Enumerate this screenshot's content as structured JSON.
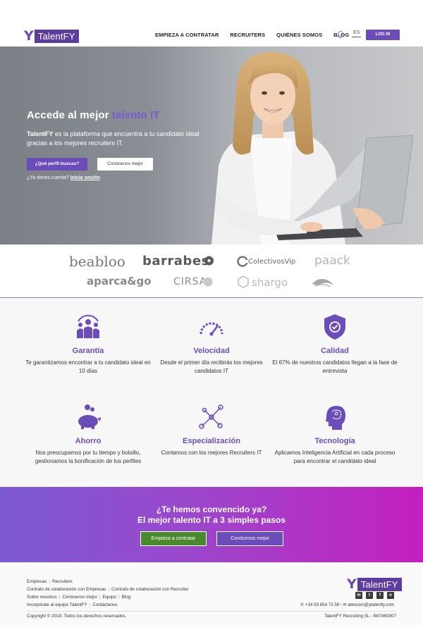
{
  "header": {
    "logo_text": "TalentFY",
    "nav": [
      "EMPIEZA A CONTRATAR",
      "RECRUITERS",
      "QUIÉNES SOMOS",
      "BLOG"
    ],
    "lang": "ES",
    "login": "LOG IN"
  },
  "hero": {
    "title_start": "Accede al mejor ",
    "title_accent": "talento IT",
    "desc_brand": "TalentFY",
    "desc_rest": " es la plataforma que encuentra a tu candidato ideal gracias a los mejores recruiters IT.",
    "btn_primary": "¿Qué perfil buscas?",
    "btn_secondary": "Conócenos mejor",
    "account_q": "¿Ya tienes cuenta? ",
    "account_link": "Inicia sesión"
  },
  "clients": [
    "beabloo",
    "barrabes",
    "ColectivosVip",
    "paack",
    "aparca&go",
    "CIRSA",
    "shargo"
  ],
  "features": [
    {
      "icon": "team-icon",
      "title": "Garantía",
      "text": "Te garantizamos encontrar a tu candidato ideal en 10 días"
    },
    {
      "icon": "speedometer-icon",
      "title": "Velocidad",
      "text": "Desde el primer día recibirás los mejores candidatos IT"
    },
    {
      "icon": "shield-check-icon",
      "title": "Calidad",
      "text": "El 67% de nuestros candidatos llegan a la fase de entrevista"
    },
    {
      "icon": "piggy-bank-icon",
      "title": "Ahorro",
      "text": "Nos preocupamos por tu tiempo y bolsillo, gestionamos la bonificación de tus perfiles"
    },
    {
      "icon": "network-icon",
      "title": "Especialización",
      "text": "Contamos con los mejores Recruiters IT"
    },
    {
      "icon": "ai-head-icon",
      "title": "Tecnología",
      "text": "Aplicamos Inteligencia Artificial en cada proceso para encontrar el candidato ideal"
    }
  ],
  "cta": {
    "line1": "¿Te hemos convencido ya?",
    "line2": "El mejor talento IT a 3 simples pasos",
    "btn1": "Empieza a contratar",
    "btn2": "Conócenos mejor"
  },
  "footer": {
    "row1": [
      "Empresas",
      "Recruiters"
    ],
    "row2": [
      "Contrato de colaboración con Empresas",
      "Contrato de colaboración con Recruiter"
    ],
    "row3": [
      "Sobre nosotros",
      "Conócenos mejor",
      "Equipo",
      "Blog"
    ],
    "row4": [
      "Incorpórate al equipo TalentFY",
      "Contáctanos"
    ],
    "logo_text": "TalentFY",
    "phone": "+34 93 854 73 58",
    "email": "atencion@ytalentfy.com",
    "copyright": "Copyright © 2019. Todos los derechos reservados.",
    "company": "TalentFY Recruiting SL - B67460907"
  },
  "colors": {
    "brand": "#6a4db8",
    "cta_green": "#4a8a2e",
    "cta_gradient_end": "#c41fbf"
  }
}
